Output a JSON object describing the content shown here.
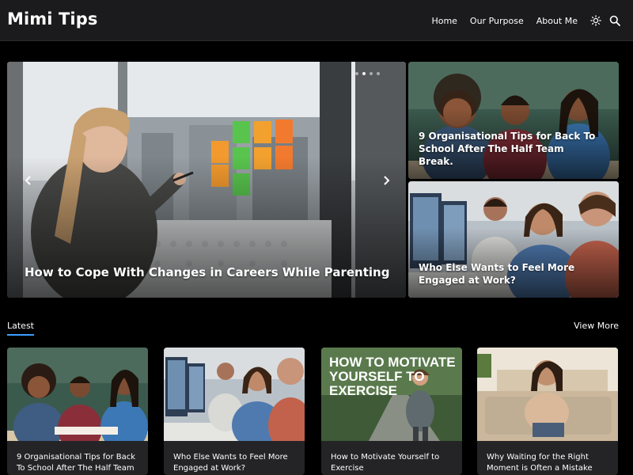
{
  "site": {
    "title": "Mimi Tips"
  },
  "nav": {
    "items": [
      "Home",
      "Our Purpose",
      "About Me"
    ],
    "theme_icon": "sun-icon",
    "search_icon": "search-icon"
  },
  "hero": {
    "main": {
      "title": "How to Cope With Changes in Careers While Parenting"
    },
    "side": [
      {
        "title": "9 Organisational Tips for Back To School After The Half Team Break."
      },
      {
        "title": "Who Else Wants to Feel More Engaged at Work?"
      }
    ],
    "slider": {
      "dots": 4,
      "active": 1,
      "prev_icon": "chevron-left-icon",
      "next_icon": "chevron-right-icon"
    }
  },
  "latest": {
    "heading": "Latest",
    "view_more": "View More",
    "accent": "#3aa0ff",
    "cards": [
      {
        "title": "9 Organisational Tips for Back To School After The Half Team"
      },
      {
        "title": "Who Else Wants to Feel More Engaged at Work?"
      },
      {
        "title": "How to Motivate Yourself to Exercise",
        "thumb_text": [
          "HOW TO MOTIVATE",
          "YOURSELF TO",
          "EXERCISE"
        ]
      },
      {
        "title": "Why Waiting for the Right Moment is Often a Mistake"
      }
    ]
  }
}
